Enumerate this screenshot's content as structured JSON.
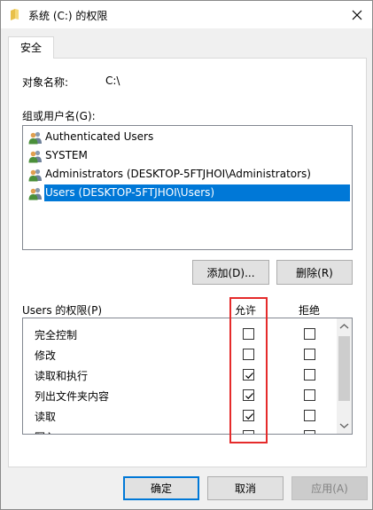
{
  "window": {
    "title": "系统 (C:) 的权限"
  },
  "tab": {
    "label": "安全"
  },
  "object": {
    "label": "对象名称:",
    "value": "C:\\"
  },
  "groups": {
    "label": "组或用户名(G):",
    "users": [
      {
        "name": "Authenticated Users",
        "selected": false
      },
      {
        "name": "SYSTEM",
        "selected": false
      },
      {
        "name": "Administrators (DESKTOP-5FTJHOI\\Administrators)",
        "selected": false
      },
      {
        "name": "Users (DESKTOP-5FTJHOI\\Users)",
        "selected": true
      }
    ]
  },
  "buttons": {
    "add": "添加(D)...",
    "remove": "删除(R)"
  },
  "permissions": {
    "label": "Users 的权限(P)",
    "allow_header": "允许",
    "deny_header": "拒绝",
    "rows": [
      {
        "name": "完全控制",
        "allow": false,
        "deny": false
      },
      {
        "name": "修改",
        "allow": false,
        "deny": false
      },
      {
        "name": "读取和执行",
        "allow": true,
        "deny": false
      },
      {
        "name": "列出文件夹内容",
        "allow": true,
        "deny": false
      },
      {
        "name": "读取",
        "allow": true,
        "deny": false
      },
      {
        "name": "写入",
        "allow": false,
        "deny": false
      }
    ]
  },
  "footer": {
    "ok": "确定",
    "cancel": "取消",
    "apply": "应用(A)"
  },
  "colors": {
    "selection": "#0078d7",
    "highlight_box": "#e52b2b"
  },
  "icons": {
    "title": "folder-icon",
    "user": "users-group-icon",
    "close": "close-icon"
  }
}
